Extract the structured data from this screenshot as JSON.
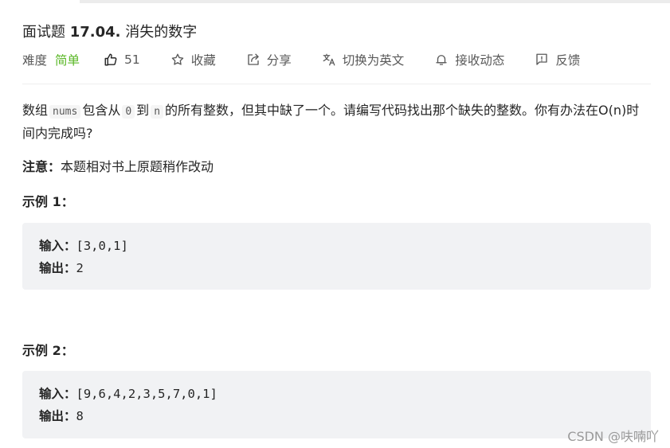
{
  "problem": {
    "title_prefix": "面试题",
    "title_num": "17.04.",
    "title_name": "消失的数字"
  },
  "meta": {
    "difficulty_label": "难度",
    "difficulty": "简单",
    "likes": "51",
    "favorite": "收藏",
    "share": "分享",
    "translate": "切换为英文",
    "accept": "接收动态",
    "feedback": "反馈",
    "difficulty_color": "#5ab726"
  },
  "description": {
    "part1": "数组",
    "code1": "nums",
    "part2": "包含从",
    "code2": "0",
    "part3": "到",
    "code3": "n",
    "part4": "的所有整数，但其中缺了一个。请编写代码找出那个缺失的整数。你有办法在O(n)时间内完成吗?"
  },
  "note": {
    "label": "注意：",
    "text": "本题相对书上原题稍作改动"
  },
  "examples": [
    {
      "title": "示例 1：",
      "input_label": "输入：",
      "input": "[3,0,1]",
      "output_label": "输出：",
      "output": "2"
    },
    {
      "title": "示例 2：",
      "input_label": "输入：",
      "input": "[9,6,4,2,3,5,7,0,1]",
      "output_label": "输出：",
      "output": "8"
    }
  ],
  "watermark": "CSDN @呋喃吖"
}
